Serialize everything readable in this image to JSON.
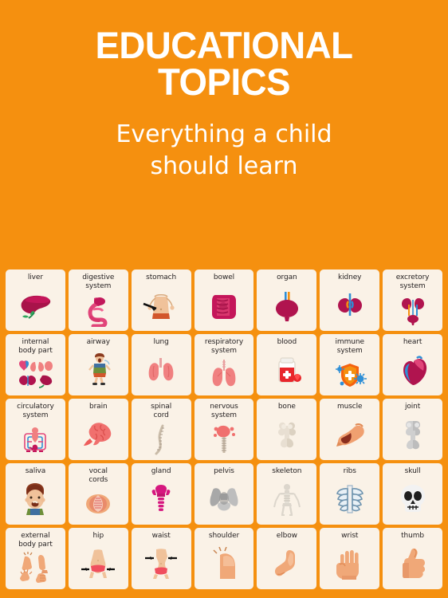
{
  "header": {
    "title_line1": "EDUCATIONAL",
    "title_line2": "TOPICS",
    "subtitle_line1": "Everything a child",
    "subtitle_line2": "should learn"
  },
  "colors": {
    "background": "#F5900F",
    "card_background": "#FAF2E7",
    "title_text": "#FFFFFF",
    "label_text": "#231F20"
  },
  "grid": {
    "columns": 7,
    "rows": 5,
    "cards": [
      {
        "label": "liver",
        "icon": "liver-icon"
      },
      {
        "label": "digestive\nsystem",
        "icon": "digestive-system-icon"
      },
      {
        "label": "stomach",
        "icon": "stomach-icon"
      },
      {
        "label": "bowel",
        "icon": "bowel-icon"
      },
      {
        "label": "organ",
        "icon": "organ-bladder-icon"
      },
      {
        "label": "kidney",
        "icon": "kidney-icon"
      },
      {
        "label": "excretory\nsystem",
        "icon": "excretory-system-icon"
      },
      {
        "label": "internal\nbody part",
        "icon": "internal-body-part-icon"
      },
      {
        "label": "airway",
        "icon": "airway-icon"
      },
      {
        "label": "lung",
        "icon": "lung-icon"
      },
      {
        "label": "respiratory\nsystem",
        "icon": "respiratory-system-icon"
      },
      {
        "label": "blood",
        "icon": "blood-icon"
      },
      {
        "label": "immune\nsystem",
        "icon": "immune-system-icon"
      },
      {
        "label": "heart",
        "icon": "heart-icon"
      },
      {
        "label": "circulatory\nsystem",
        "icon": "circulatory-system-icon"
      },
      {
        "label": "brain",
        "icon": "brain-icon"
      },
      {
        "label": "spinal\ncord",
        "icon": "spinal-cord-icon"
      },
      {
        "label": "nervous\nsystem",
        "icon": "nervous-system-icon"
      },
      {
        "label": "bone",
        "icon": "bone-icon"
      },
      {
        "label": "muscle",
        "icon": "muscle-icon"
      },
      {
        "label": "joint",
        "icon": "joint-icon"
      },
      {
        "label": "saliva",
        "icon": "saliva-icon"
      },
      {
        "label": "vocal\ncords",
        "icon": "vocal-cords-icon"
      },
      {
        "label": "gland",
        "icon": "gland-icon"
      },
      {
        "label": "pelvis",
        "icon": "pelvis-icon"
      },
      {
        "label": "skeleton",
        "icon": "skeleton-icon"
      },
      {
        "label": "ribs",
        "icon": "ribs-icon"
      },
      {
        "label": "skull",
        "icon": "skull-icon"
      },
      {
        "label": "external\nbody part",
        "icon": "external-body-part-icon"
      },
      {
        "label": "hip",
        "icon": "hip-icon"
      },
      {
        "label": "waist",
        "icon": "waist-icon"
      },
      {
        "label": "shoulder",
        "icon": "shoulder-icon"
      },
      {
        "label": "elbow",
        "icon": "elbow-icon"
      },
      {
        "label": "wrist",
        "icon": "wrist-icon"
      },
      {
        "label": "thumb",
        "icon": "thumb-icon"
      }
    ]
  }
}
